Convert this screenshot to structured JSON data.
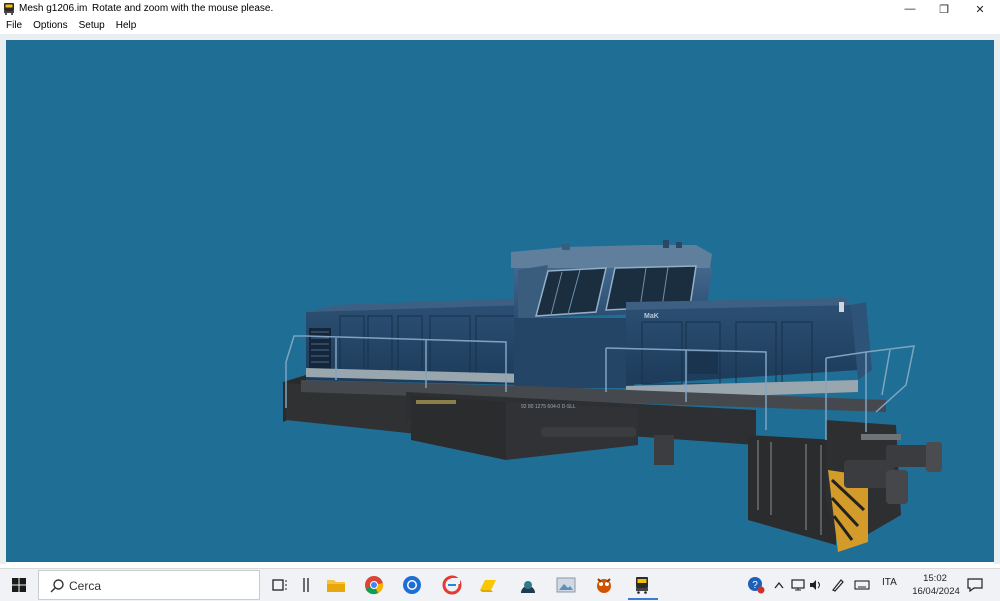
{
  "window": {
    "title": "Mesh g1206.im",
    "message": "Rotate and zoom with the mouse please.",
    "controls": {
      "minimize": "—",
      "maximize": "❐",
      "close": "✕"
    }
  },
  "menu": {
    "items": [
      "File",
      "Options",
      "Setup",
      "Help"
    ]
  },
  "viewport": {
    "background_color": "#1f6e96",
    "model": {
      "type": "diesel locomotive",
      "brand_plate": "MaK",
      "side_number": "92 80 1275 604-0 D-SLL"
    }
  },
  "taskbar": {
    "search_placeholder": "Cerca",
    "apps": [
      "task-view-icon",
      "divider-icon",
      "file-explorer-icon",
      "chrome-icon",
      "firefox-icon",
      "ccleaner-icon",
      "drive-icon",
      "network-icon",
      "image-viewer-icon",
      "game-icon",
      "locomotive-app-icon"
    ],
    "tray": {
      "language": "ITA",
      "time": "15:02",
      "date": "16/04/2024"
    }
  }
}
